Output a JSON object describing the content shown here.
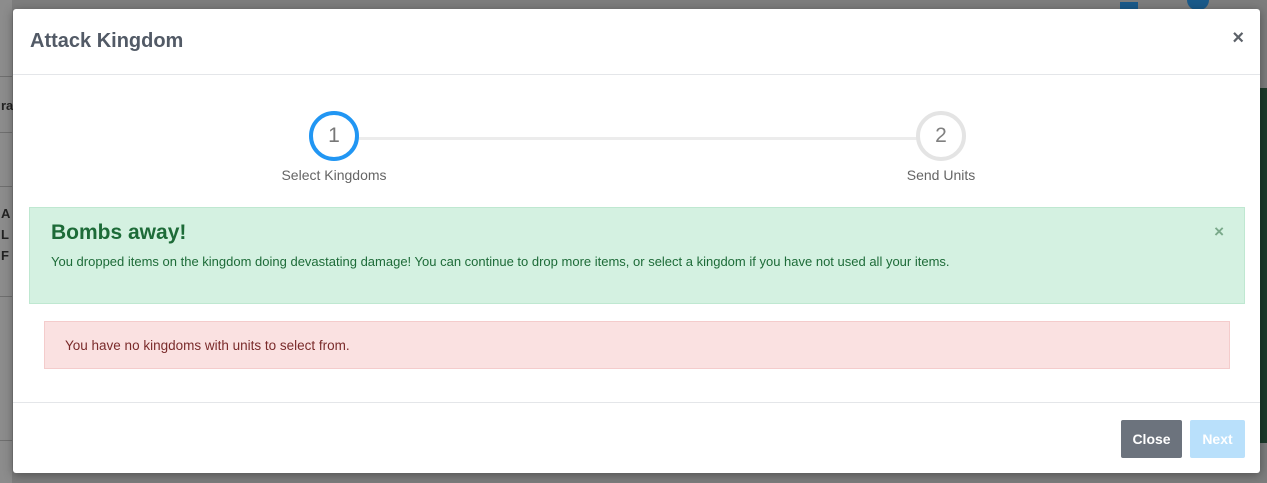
{
  "modal": {
    "title": "Attack Kingdom",
    "close_icon": "×"
  },
  "steps": [
    {
      "number": "1",
      "label": "Select Kingdoms"
    },
    {
      "number": "2",
      "label": "Send Units"
    }
  ],
  "alert_success": {
    "title": "Bombs away!",
    "text": "You dropped items on the kingdom doing devastating damage! You can continue to drop more items, or select a kingdom if you have not used all your items.",
    "dismiss_icon": "×"
  },
  "alert_danger": {
    "text": "You have no kingdoms with units to select from."
  },
  "footer": {
    "close_label": "Close",
    "next_label": "Next"
  },
  "colors": {
    "step_active": "#2196f3",
    "success_bg": "#d4f1e1",
    "danger_bg": "#fae1e1",
    "close_button": "#6c737d",
    "next_button_disabled": "#b9e0fb"
  },
  "background_fragments": [
    "ra",
    "A",
    "L",
    "F"
  ]
}
